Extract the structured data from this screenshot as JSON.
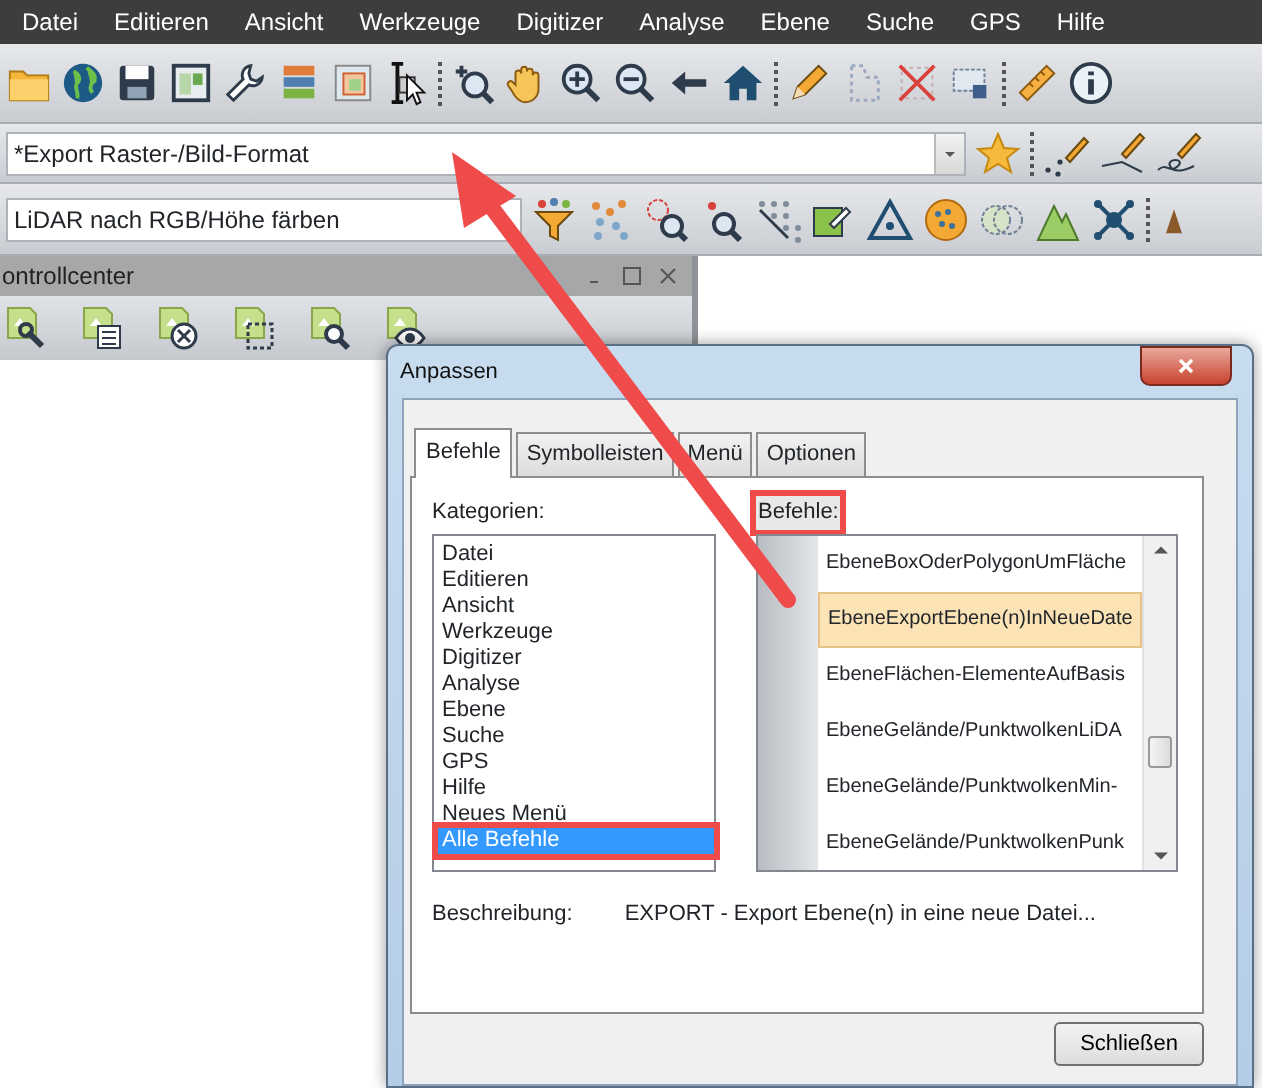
{
  "menu": [
    {
      "label": "Datei"
    },
    {
      "label": "Editieren"
    },
    {
      "label": "Ansicht"
    },
    {
      "label": "Werkzeuge"
    },
    {
      "label": "Digitizer"
    },
    {
      "label": "Analyse"
    },
    {
      "label": "Ebene"
    },
    {
      "label": "Suche"
    },
    {
      "label": "GPS"
    },
    {
      "label": "Hilfe"
    }
  ],
  "format_combo": {
    "value": "*Export Raster-/Bild-Format"
  },
  "lidar_combo": {
    "value": "LiDAR nach RGB/Höhe färben"
  },
  "panel": {
    "title": "ontrollcenter"
  },
  "dialog": {
    "title": "Anpassen",
    "tabs": [
      {
        "label": "Befehle",
        "selected": true
      },
      {
        "label": "Symbolleisten",
        "selected": false
      },
      {
        "label": "Menü",
        "selected": false
      },
      {
        "label": "Optionen",
        "selected": false
      }
    ],
    "categories_label": "Kategorien:",
    "categories": [
      {
        "label": "Datei",
        "selected": false,
        "annotated": false
      },
      {
        "label": "Editieren",
        "selected": false,
        "annotated": false
      },
      {
        "label": "Ansicht",
        "selected": false,
        "annotated": false
      },
      {
        "label": "Werkzeuge",
        "selected": false,
        "annotated": false
      },
      {
        "label": "Digitizer",
        "selected": false,
        "annotated": false
      },
      {
        "label": "Analyse",
        "selected": false,
        "annotated": false
      },
      {
        "label": "Ebene",
        "selected": false,
        "annotated": false
      },
      {
        "label": "Suche",
        "selected": false,
        "annotated": false
      },
      {
        "label": "GPS",
        "selected": false,
        "annotated": false
      },
      {
        "label": "Hilfe",
        "selected": false,
        "annotated": false
      },
      {
        "label": "Neues Menü",
        "selected": false,
        "annotated": false
      },
      {
        "label": "Alle Befehle",
        "selected": true,
        "annotated": true
      }
    ],
    "commands_label": {
      "text": "Befehle:",
      "annotated": true
    },
    "commands": [
      {
        "label": "EbeneBoxOderPolygonUmFläche",
        "selected": false
      },
      {
        "label": "EbeneExportEbene(n)InNeueDate",
        "selected": true
      },
      {
        "label": "EbeneFlächen-ElementeAufBasis",
        "selected": false
      },
      {
        "label": "EbeneGelände/PunktwolkenLiDA",
        "selected": false
      },
      {
        "label": "EbeneGelände/PunktwolkenMin-",
        "selected": false
      },
      {
        "label": "EbeneGelände/PunktwolkenPunk",
        "selected": false
      }
    ],
    "description_label": "Beschreibung:",
    "description": "EXPORT - Export Ebene(n) in eine neue Datei...",
    "close_button": "Schließen"
  }
}
